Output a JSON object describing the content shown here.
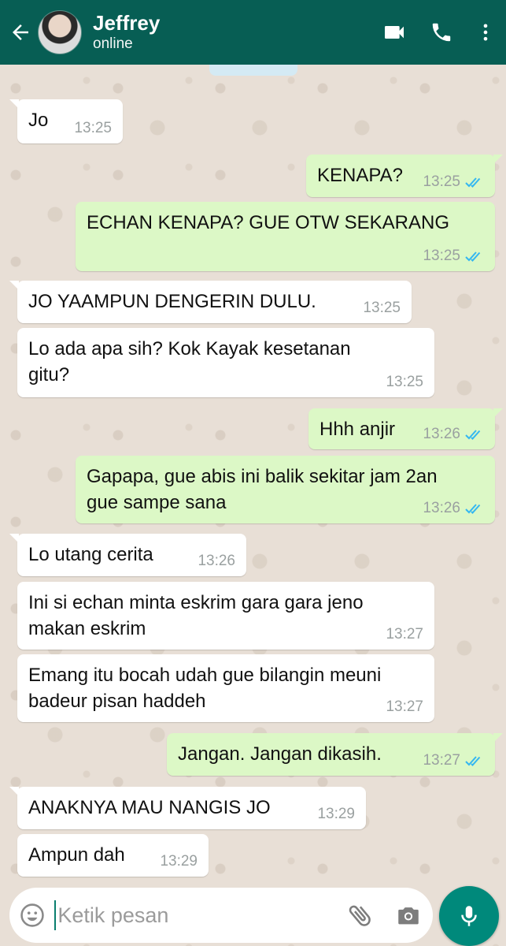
{
  "header": {
    "contact_name": "Jeffrey",
    "status": "online",
    "colors": {
      "bar": "#075e54"
    },
    "icons": [
      "back-arrow-icon",
      "video-call-icon",
      "phone-icon",
      "more-vert-icon"
    ]
  },
  "messages": [
    {
      "dir": "in",
      "text": "Jo",
      "time": "13:25"
    },
    {
      "dir": "out",
      "text": "KENAPA?",
      "time": "13:25",
      "read": true
    },
    {
      "dir": "out",
      "text": "ECHAN KENAPA? GUE OTW SEKARANG",
      "time": "13:25",
      "read": true
    },
    {
      "dir": "in",
      "text": "JO YAAMPUN DENGERIN DULU.",
      "time": "13:25"
    },
    {
      "dir": "in",
      "text": "Lo ada apa sih? Kok Kayak kesetanan\ngitu?",
      "time": "13:25"
    },
    {
      "dir": "out",
      "text": "Hhh anjir",
      "time": "13:26",
      "read": true
    },
    {
      "dir": "out",
      "text": "Gapapa, gue abis ini balik sekitar jam 2an\ngue sampe sana",
      "time": "13:26",
      "read": true
    },
    {
      "dir": "in",
      "text": "Lo utang cerita",
      "time": "13:26"
    },
    {
      "dir": "in",
      "text": "Ini si echan minta eskrim gara gara jeno\nmakan eskrim",
      "time": "13:27"
    },
    {
      "dir": "in",
      "text": "Emang itu bocah udah gue bilangin meuni\nbadeur pisan haddeh",
      "time": "13:27"
    },
    {
      "dir": "out",
      "text": "Jangan. Jangan dikasih.",
      "time": "13:27",
      "read": true
    },
    {
      "dir": "in",
      "text": "ANAKNYA MAU NANGIS JO",
      "time": "13:29"
    },
    {
      "dir": "in",
      "text": "Ampun dah",
      "time": "13:29"
    }
  ],
  "composer": {
    "placeholder": "Ketik pesan",
    "icons": [
      "emoji-icon",
      "attach-icon",
      "camera-icon",
      "mic-icon"
    ]
  },
  "colors": {
    "incoming": "#ffffff",
    "outgoing": "#dcf8c6",
    "read_tick": "#34b7f1",
    "accent": "#00897b"
  }
}
